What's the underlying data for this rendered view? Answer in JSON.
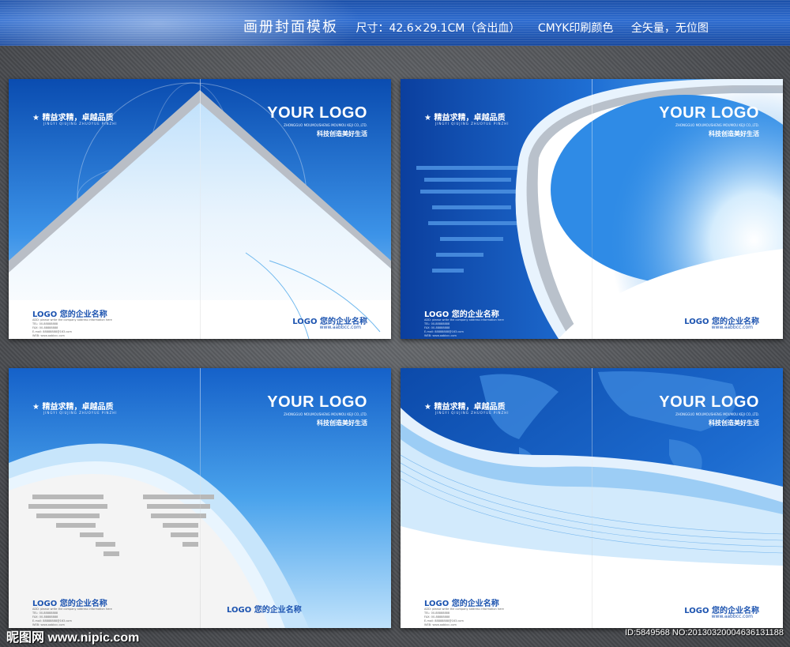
{
  "header": {
    "title": "画册封面模板",
    "size": "尺寸：42.6×29.1CM（含出血）",
    "color_mode": "CMYK印刷颜色",
    "vector": "全矢量，无位图"
  },
  "cover": {
    "slogan": "★ 精益求精，卓越品质",
    "slogan_pinyin": "JINGYI QIUJING      ZHUOYUE PINZHI",
    "logo": "YOUR LOGO",
    "logo_sub": "ZHONGGUO MOUMOUSHENG MOUMOU KEJI CO.,LTD.",
    "tagline": "科技创造美好生活",
    "company": "LOGO 您的企业名称",
    "address_lines": [
      "ADD: please write the company address information here",
      "TEL: 00-88888888",
      "FAX: 00-88888888",
      "E-mail: 88888888@163.com",
      "WEB: www.aabbcc.com"
    ],
    "url": "www.aabbcc.com"
  },
  "footer": {
    "site": "昵图网 www.nipic.com",
    "id": "ID:5849568 NO:20130320004636131188"
  },
  "colors": {
    "deep_blue": "#0d4fb5",
    "mid_blue": "#2c86e6",
    "light_blue": "#cfe6fb",
    "text_blue": "#1d54b0"
  },
  "icons": {
    "globe": "globe-icon",
    "world_map": "world-map-icon",
    "star": "star-icon"
  }
}
